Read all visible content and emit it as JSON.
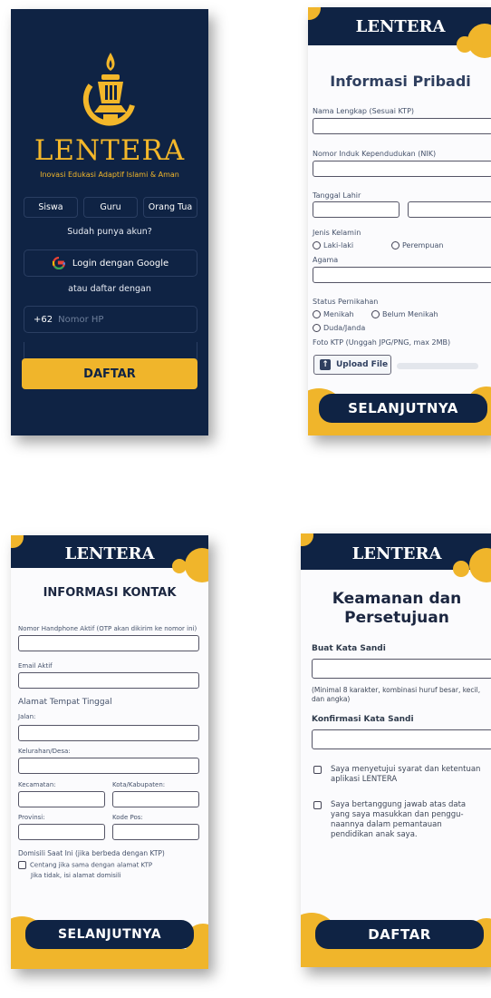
{
  "screen1": {
    "brand": "LENTERA",
    "tagline": "Inovasi Edukasi Adaptif Islami & Aman",
    "roles": [
      "Siswa",
      "Guru",
      "Orang Tua"
    ],
    "login_prompt": "Sudah punya akun?",
    "google_button": "Login dengan Google",
    "or_register": "atau daftar dengan",
    "country_code": "+62",
    "phone_placeholder": "Nomor HP",
    "submit": "DAFTAR"
  },
  "screen2": {
    "header": "LENTERA",
    "title": "Informasi Pribadi",
    "name_label": "Nama Lengkap (Sesuai KTP)",
    "nik_label": "Nomor Induk Kependudukan (NIK)",
    "dob_label": "Tanggal Lahir",
    "gender_label": "Jenis Kelamin",
    "gender_options": [
      "Laki-laki",
      "Perempuan"
    ],
    "religion_label": "Agama",
    "marital_label": "Status Pernikahan",
    "marital_options": [
      "Menikah",
      "Belum Menikah",
      "Duda/Janda"
    ],
    "ktp_label": "Foto KTP (Unggah JPG/PNG, max 2MB)",
    "upload_button": "Upload File",
    "next": "SELANJUTNYA"
  },
  "screen3": {
    "header": "LENTERA",
    "title": "INFORMASI KONTAK",
    "phone_label": "Nomor Handphone Aktif (OTP akan dikirim ke nomor ini)",
    "email_label": "Email Aktif",
    "address_label": "Alamat Tempat Tinggal",
    "street_label": "Jalan:",
    "village_label": "Kelurahan/Desa:",
    "district_label": "Kecamatan:",
    "city_label": "Kota/Kabupaten:",
    "province_label": "Provinsi:",
    "postal_label": "Kode Pos:",
    "domicile_label": "Domisili Saat Ini (jika berbeda dengan KTP)",
    "same_address_check": "Centang jika sama dengan alamat KTP",
    "else_note": "Jika tidak, isi alamat domisili",
    "next": "SELANJUTNYA"
  },
  "screen4": {
    "header": "LENTERA",
    "title_line1": "Keamanan dan",
    "title_line2": "Persetujuan",
    "password_label": "Buat Kata Sandi",
    "password_hint": "(Minimal 8 karakter, kombinasi huruf besar, kecil, dan angka)",
    "confirm_label": "Konfirmasi Kata Sandi",
    "agree_terms": "Saya menyetujui syarat dan ketentuan aplikasi LENTERA",
    "agree_responsibility": "Saya bertanggung jawab atas data yang saya masukkan dan penggu-naannya dalam pemantauan pendidikan anak saya.",
    "submit": "DAFTAR"
  },
  "colors": {
    "navy": "#0f2344",
    "gold": "#f0b52b"
  }
}
